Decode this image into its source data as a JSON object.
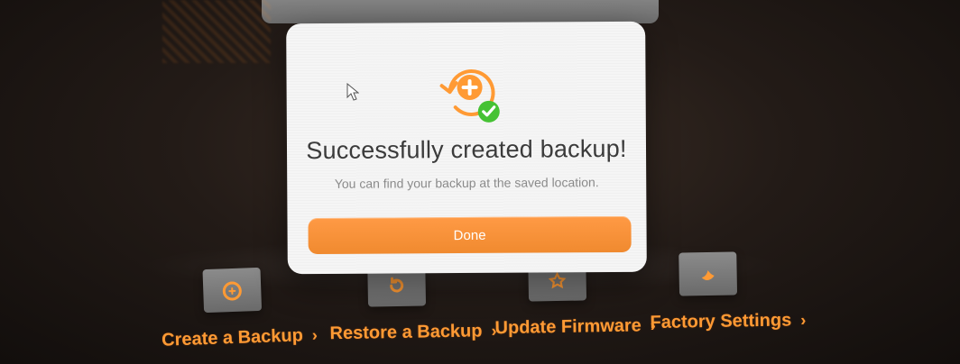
{
  "dialog": {
    "title": "Successfully created backup!",
    "message": "You can find your backup at the saved location.",
    "done_label": "Done",
    "icon": "backup-success-icon"
  },
  "actions": [
    {
      "label": "Create a Backup",
      "icon": "backup-icon"
    },
    {
      "label": "Restore a Backup",
      "icon": "restore-icon"
    },
    {
      "label": "Update Firmware",
      "icon": "firmware-icon"
    },
    {
      "label": "Factory Settings",
      "icon": "factory-icon"
    }
  ],
  "chevron": "›",
  "colors": {
    "accent": "#ff9a34",
    "success": "#46c234",
    "dialog_bg": "#f5f5f5",
    "text": "#3b3b3b",
    "muted_text": "#8a8a8a"
  }
}
